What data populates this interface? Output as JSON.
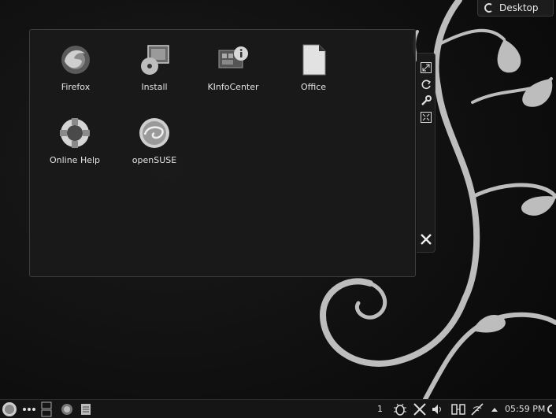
{
  "desktop_button": {
    "label": "Desktop",
    "icon": "kde-icon"
  },
  "folder_view": {
    "icons": [
      {
        "label": "Firefox",
        "icon": "firefox-icon"
      },
      {
        "label": "Install",
        "icon": "install-icon"
      },
      {
        "label": "KInfoCenter",
        "icon": "kinfocenter-icon"
      },
      {
        "label": "Office",
        "icon": "office-icon"
      },
      {
        "label": "Online Help",
        "icon": "online-help-icon"
      },
      {
        "label": "openSUSE",
        "icon": "opensuse-icon"
      }
    ]
  },
  "widget_handle": {
    "buttons": [
      "resize-icon",
      "rotate-icon",
      "settings-wrench-icon",
      "maximize-icon",
      "close-icon"
    ]
  },
  "taskbar": {
    "virtual_desktop": "1",
    "clock": "05:59 PM",
    "launcher_icon": "application-launcher-icon",
    "tray_icons": [
      "bug-icon",
      "tools-icon",
      "volume-icon",
      "battery-icon",
      "network-icon",
      "up-arrow-icon"
    ]
  },
  "colors": {
    "background": "#101010",
    "panel": "#1a1a1a",
    "swirl": "#bdbdbd"
  }
}
